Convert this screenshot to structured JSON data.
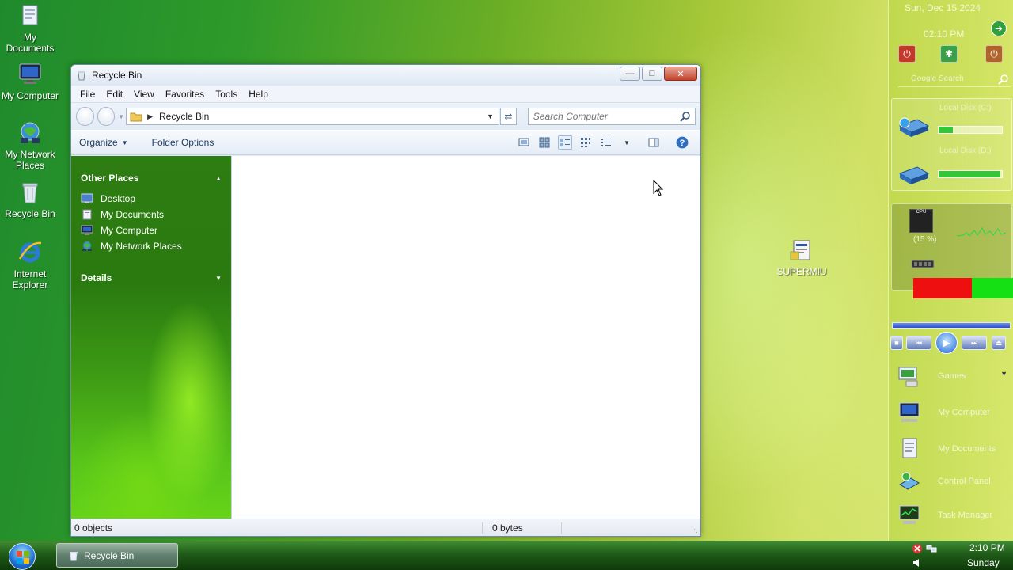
{
  "desktop": {
    "icons": [
      {
        "label": "My Documents"
      },
      {
        "label": "My Computer"
      },
      {
        "label": "My Network Places"
      },
      {
        "label": "Recycle Bin"
      },
      {
        "label": "Internet Explorer"
      }
    ],
    "file_label": "SUPERMIU"
  },
  "window": {
    "title": "Recycle Bin",
    "menu": [
      "File",
      "Edit",
      "View",
      "Favorites",
      "Tools",
      "Help"
    ],
    "address": "Recycle Bin",
    "search_placeholder": "Search Computer",
    "commands": {
      "organize": "Organize",
      "folder_options": "Folder Options"
    },
    "left_pane": {
      "other_places_title": "Other Places",
      "places": [
        "Desktop",
        "My Documents",
        "My Computer",
        "My Network Places"
      ],
      "details_title": "Details"
    },
    "status": {
      "objects": "0 objects",
      "size": "0 bytes"
    }
  },
  "sidebar": {
    "date": "Sun, Dec 15 2024",
    "time": "02:10 PM",
    "search_placeholder": "Google Search",
    "drives": [
      {
        "label": "Local Disk (C:)",
        "used": 0.22
      },
      {
        "label": "Local Disk (D:)",
        "used": 0.98
      }
    ],
    "cpu_percent": "(15 %)",
    "links": [
      {
        "label": "Games"
      },
      {
        "label": "My Computer"
      },
      {
        "label": "My Documents"
      },
      {
        "label": "Control Panel"
      },
      {
        "label": "Task Manager"
      }
    ]
  },
  "taskbar": {
    "task_label": "Recycle Bin",
    "clock": "2:10 PM",
    "day": "Sunday"
  },
  "colors": {
    "taskbar": "#1f5a18",
    "left_pane_green": "#2d7d12",
    "memory_red": "#ee1010",
    "memory_green": "#14e014"
  }
}
